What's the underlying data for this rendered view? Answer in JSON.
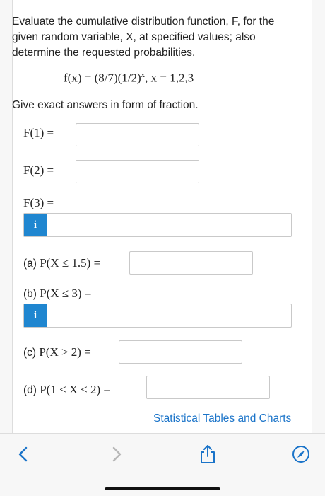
{
  "intro_text": "Evaluate the cumulative distribution function, F, for the given random variable, X, at specified values; also determine the requested probabilities.",
  "formula": {
    "lhs": "f(x) = (8/7)(1/2)",
    "exponent": "x",
    "rhs": ", x = 1,2,3"
  },
  "instruction": "Give exact answers in form of fraction.",
  "fields": {
    "F1_label": "F(1) =",
    "F2_label": "F(2) =",
    "F3_label": "F(3) =",
    "a_prefix": "(a)",
    "a_label": "P(X ≤ 1.5) =",
    "b_prefix": "(b)",
    "b_label": "P(X ≤ 3) =",
    "c_prefix": "(c)",
    "c_label": "P(X > 2) =",
    "d_prefix": "(d)",
    "d_label": "P(1 < X ≤ 2) =",
    "info_glyph": "i"
  },
  "link_text": "Statistical Tables and Charts",
  "toolbar": {
    "back": "chevron-left-icon",
    "forward": "chevron-right-icon",
    "share": "share-icon",
    "compass": "compass-icon",
    "accent": "#1b74c9"
  }
}
